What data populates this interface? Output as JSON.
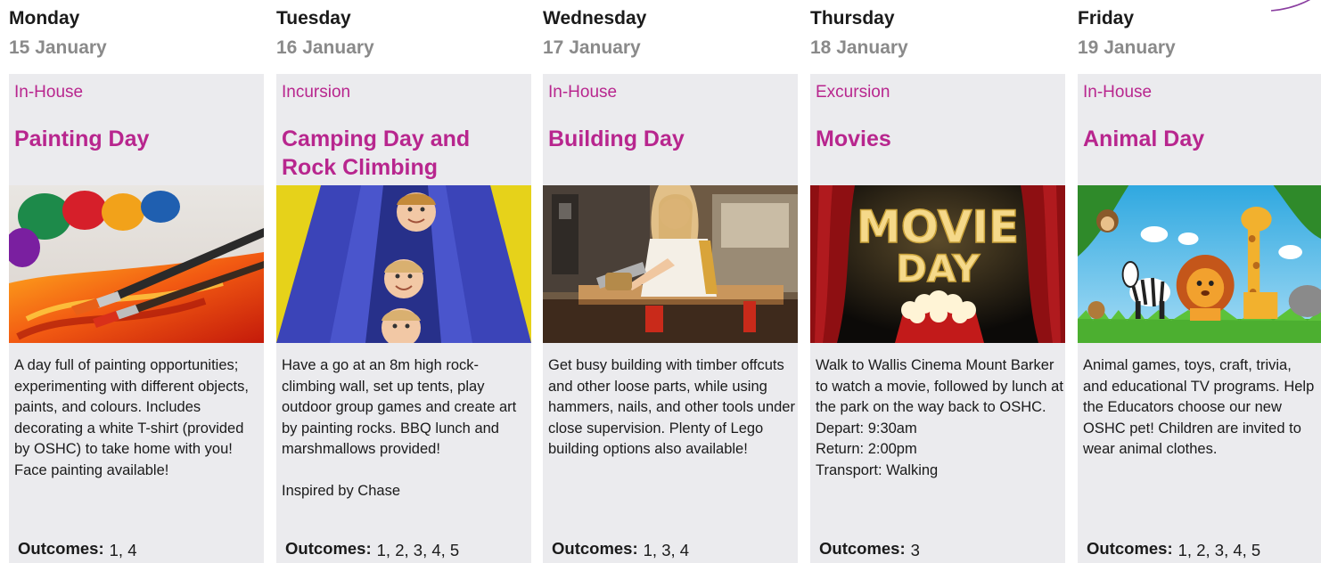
{
  "days": [
    {
      "day": "Monday",
      "date": "15 January",
      "category": "In-House",
      "title": "Painting Day",
      "image": "paint-tubes-and-brushes",
      "description": [
        "A day full of painting opportunities; experimenting with different objects, paints, and colours. Includes decorating a white T-shirt (provided by OSHC) to take home with you!",
        "Face painting available!"
      ],
      "outcomes_label": "Outcomes:",
      "outcomes": "1, 4"
    },
    {
      "day": "Tuesday",
      "date": "16 January",
      "category": "Incursion",
      "title": "Camping Day and Rock Climbing",
      "image": "children-in-tent",
      "description": [
        "Have a go at an 8m high rock-climbing wall, set up tents, play outdoor group games and create art by painting rocks. BBQ lunch and marshmallows provided!",
        "",
        "Inspired by Chase"
      ],
      "outcomes_label": "Outcomes:",
      "outcomes": "1, 2, 3, 4, 5"
    },
    {
      "day": "Wednesday",
      "date": "17 January",
      "category": "In-House",
      "title": "Building Day",
      "image": "girl-sawing-timber",
      "description": [
        "Get busy building with timber offcuts and other loose parts, while using hammers, nails, and other tools under close supervision. Plenty of Lego building options also available!"
      ],
      "outcomes_label": "Outcomes:",
      "outcomes": "1, 3, 4"
    },
    {
      "day": "Thursday",
      "date": "18 January",
      "category": "Excursion",
      "title": "Movies",
      "image": "movie-day-popcorn",
      "image_text": [
        "MOVIE",
        "DAY"
      ],
      "description": [
        "Walk to Wallis Cinema Mount Barker to watch a movie, followed by lunch at the park on the way back to OSHC.",
        "Depart: 9:30am",
        "Return: 2:00pm",
        "Transport: Walking"
      ],
      "outcomes_label": "Outcomes:",
      "outcomes": "3"
    },
    {
      "day": "Friday",
      "date": "19 January",
      "category": "In-House",
      "title": "Animal Day",
      "image": "cartoon-jungle-animals",
      "description": [
        "Animal games, toys, craft, trivia, and educational TV programs. Help the Educators choose our new OSHC pet! Children are invited to wear animal clothes."
      ],
      "outcomes_label": "Outcomes:",
      "outcomes": "1, 2, 3, 4, 5"
    }
  ],
  "colors": {
    "accent": "#b8268e",
    "card_bg": "#ebebee",
    "date_grey": "#8a8a8a",
    "text": "#1a1a1a"
  }
}
